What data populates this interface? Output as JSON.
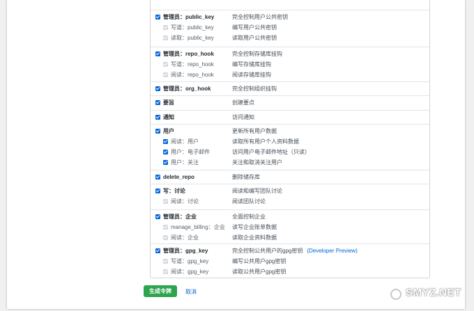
{
  "scopes": [
    {
      "label": "管理员：public_key",
      "desc": "完全控制用户公共密钥",
      "checked": true,
      "children": [
        {
          "label": "写道：public_key",
          "desc": "编写用户公共密钥",
          "checked": true,
          "disabled": true
        },
        {
          "label": "读取：public_key",
          "desc": "读取用户公共密钥",
          "checked": true,
          "disabled": true
        }
      ]
    },
    {
      "label": "管理员：repo_hook",
      "desc": "完全控制存储库挂钩",
      "checked": true,
      "children": [
        {
          "label": "写道：repo_hook",
          "desc": "编写存储库挂钩",
          "checked": true,
          "disabled": true
        },
        {
          "label": "阅读：repo_hook",
          "desc": "阅读存储库挂钩",
          "checked": true,
          "disabled": true
        }
      ]
    },
    {
      "label": "管理员：org_hook",
      "desc": "完全控制组织挂钩",
      "checked": true,
      "children": []
    },
    {
      "label": "要旨",
      "desc": "创建要点",
      "checked": true,
      "children": []
    },
    {
      "label": "通知",
      "desc": "访问通知",
      "checked": true,
      "children": []
    },
    {
      "label": "用户",
      "desc": "更新所有用户数据",
      "checked": true,
      "children": [
        {
          "label": "阅读：用户",
          "desc": "读取所有用户个人资料数据",
          "checked": true,
          "disabled": false
        },
        {
          "label": "用户：电子邮件",
          "desc": "访问用户电子邮件地址（只读）",
          "checked": true,
          "disabled": false
        },
        {
          "label": "用户：关注",
          "desc": "关注和取消关注用户",
          "checked": true,
          "disabled": false
        }
      ]
    },
    {
      "label": "delete_repo",
      "desc": "删除储存库",
      "checked": true,
      "children": []
    },
    {
      "label": "写：讨论",
      "desc": "阅读和编写团队讨论",
      "checked": true,
      "children": [
        {
          "label": "阅读：讨论",
          "desc": "阅读团队讨论",
          "checked": true,
          "disabled": true
        }
      ]
    },
    {
      "label": "管理员：企业",
      "desc": "全面控制企业",
      "checked": true,
      "children": [
        {
          "label": "manage_billing：企业",
          "desc": "读写企业账单数据",
          "checked": true,
          "disabled": true
        },
        {
          "label": "阅读：企业",
          "desc": "读取企业资料数据",
          "checked": true,
          "disabled": true
        }
      ]
    },
    {
      "label": "管理员：gpg_key",
      "desc": "完全控制公共用户的gpg密钥",
      "preview": "(Developer Preview)",
      "checked": true,
      "children": [
        {
          "label": "写道：gpg_key",
          "desc": "编写公共用户gpg密钥",
          "checked": true,
          "disabled": true
        },
        {
          "label": "阅读：gpg_key",
          "desc": "读取公共用户gpg密钥",
          "checked": true,
          "disabled": true
        }
      ]
    }
  ],
  "actions": {
    "generate_label": "生成令牌",
    "cancel_label": "取消"
  },
  "watermark": {
    "text": "SMYZ.NET",
    "sub": "值 什么值得买"
  },
  "colors": {
    "accent": "#0366d6",
    "button": "#2ea44f"
  }
}
